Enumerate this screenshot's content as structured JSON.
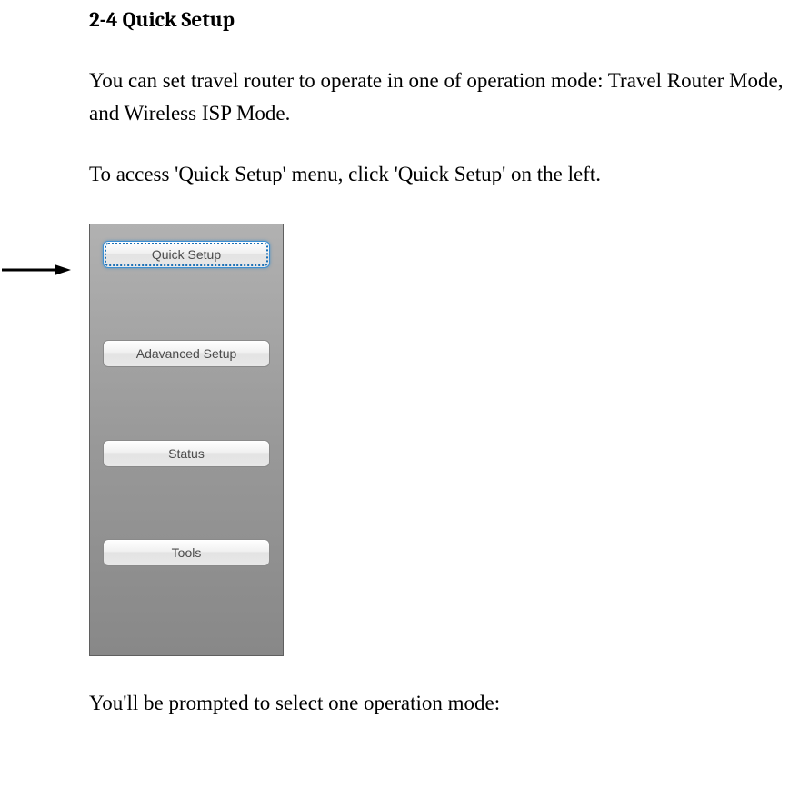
{
  "doc": {
    "heading": "2-4 Quick Setup",
    "para1": "You can set travel router to operate in one of operation mode: Travel Router Mode, and Wireless ISP Mode.",
    "para2": "To access 'Quick Setup' menu, click 'Quick Setup' on the left.",
    "para3": "You'll be prompted to select one operation mode:"
  },
  "sidebar": {
    "items": [
      {
        "label": "Quick Setup"
      },
      {
        "label": "Adavanced Setup"
      },
      {
        "label": "Status"
      },
      {
        "label": "Tools"
      }
    ]
  }
}
